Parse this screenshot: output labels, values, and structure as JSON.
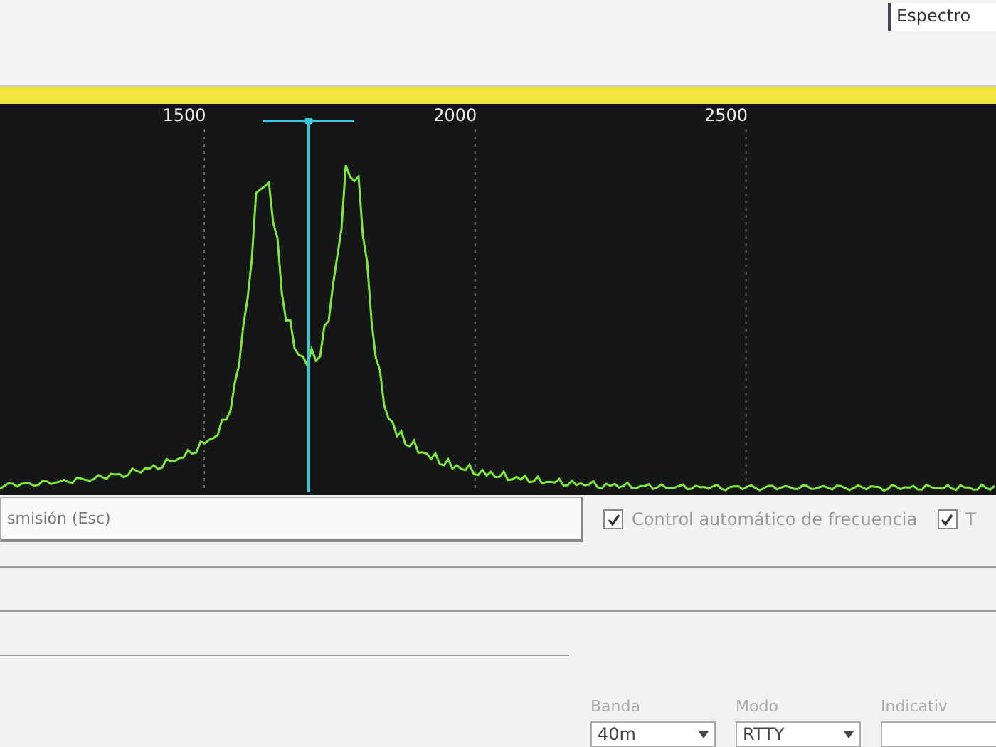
{
  "spectrum_tab": {
    "label": "Espectro"
  },
  "spectrum": {
    "ticks": [
      "1500",
      "2000",
      "2500"
    ],
    "marker": {
      "level": 0.31
    }
  },
  "controls": {
    "transmit_button": {
      "label": "smisión (Esc)"
    },
    "checkboxes": [
      {
        "label": "Control automático de frecuencia",
        "checked": true
      },
      {
        "label": "T",
        "checked": true
      }
    ]
  },
  "fields": [
    {
      "label": "Banda",
      "value": "40m"
    },
    {
      "label": "Modo",
      "value": "RTTY"
    },
    {
      "label": "Indicativ"
    }
  ]
}
